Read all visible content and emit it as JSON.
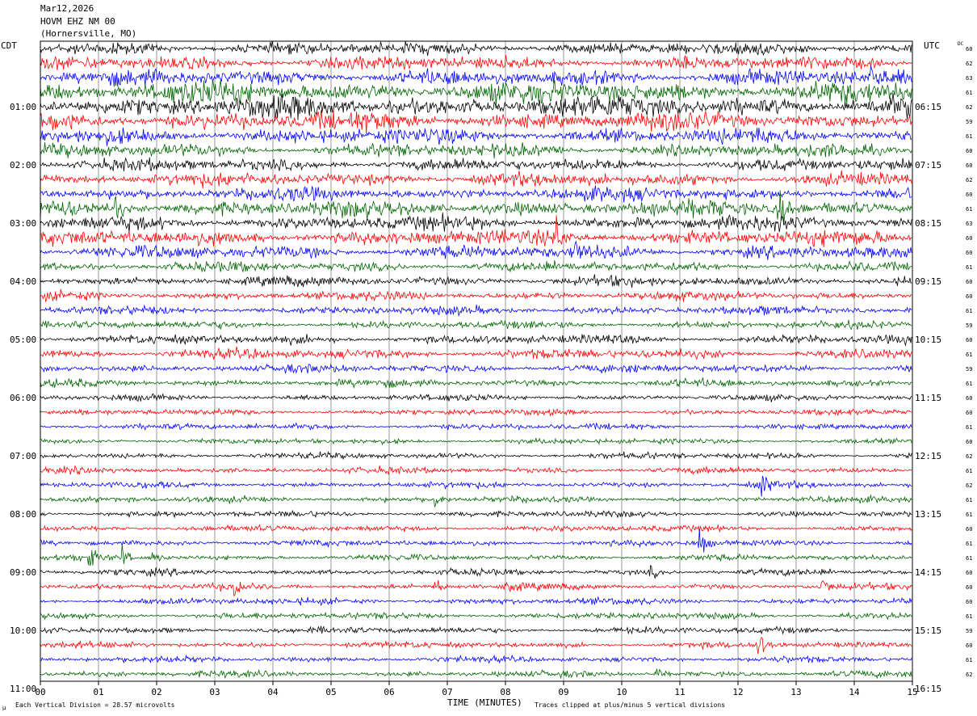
{
  "header": {
    "date": "Mar12,2026",
    "station": "HOVM EHZ NM 00",
    "location": "(Hornersville, MO)"
  },
  "labels": {
    "left_tz": "CDT",
    "right_tz": "UTC",
    "dc": "DC",
    "xlabel": "TIME (MINUTES)",
    "scale_note": "Each Vertical Division =   28.57 microvolts",
    "clip_note": "Traces clipped at plus/minus 5 vertical divisions",
    "corner_mark": "µ"
  },
  "colors": {
    "trace_cycle": [
      "#000000",
      "#ff0000",
      "#0000ff",
      "#006400"
    ],
    "grid": "#808080",
    "frame": "#000000",
    "background": "#ffffff"
  },
  "chart_data": {
    "type": "line",
    "description_type": "helicorder",
    "x_range": [
      0,
      15
    ],
    "x_ticks": [
      "00",
      "01",
      "02",
      "03",
      "04",
      "05",
      "06",
      "07",
      "08",
      "09",
      "10",
      "11",
      "12",
      "13",
      "14",
      "15"
    ],
    "trace_minutes": 15,
    "left_hour_labels": [
      "01:00",
      "02:00",
      "03:00",
      "04:00",
      "05:00",
      "06:00",
      "07:00",
      "08:00",
      "09:00",
      "10:00",
      "11:00"
    ],
    "right_hour_labels": [
      "06:15",
      "07:15",
      "08:15",
      "09:15",
      "10:15",
      "11:15",
      "12:15",
      "13:15",
      "14:15",
      "15:15",
      "16:15"
    ],
    "hour_label_first_trace": 4,
    "traces_per_hour": 4,
    "dc_offsets": [
      60,
      62,
      63,
      61,
      62,
      59,
      61,
      60,
      60,
      62,
      60,
      61,
      63,
      60,
      60,
      61,
      60,
      60,
      61,
      59,
      60,
      61,
      59,
      61,
      60,
      60,
      61,
      60,
      62,
      61,
      62,
      61,
      61,
      60,
      61,
      61,
      60,
      60,
      60,
      61,
      59,
      60,
      61,
      62
    ],
    "amplitudes": [
      0.55,
      0.6,
      0.7,
      1.0,
      1.0,
      0.85,
      0.7,
      0.6,
      0.55,
      0.6,
      0.6,
      0.75,
      0.65,
      0.7,
      0.6,
      0.45,
      0.45,
      0.4,
      0.38,
      0.35,
      0.42,
      0.45,
      0.38,
      0.35,
      0.28,
      0.27,
      0.27,
      0.25,
      0.28,
      0.28,
      0.28,
      0.28,
      0.28,
      0.28,
      0.28,
      0.27,
      0.28,
      0.28,
      0.3,
      0.3,
      0.3,
      0.28,
      0.27,
      0.28
    ],
    "events": [
      {
        "trace": 11,
        "minute": 1.3,
        "amp": 1.6
      },
      {
        "trace": 11,
        "minute": 12.7,
        "amp": 2.8
      },
      {
        "trace": 13,
        "minute": 8.9,
        "amp": 1.6
      },
      {
        "trace": 14,
        "minute": 9.2,
        "amp": 1.4
      },
      {
        "trace": 2,
        "minute": 14.3,
        "amp": 1.2
      },
      {
        "trace": 30,
        "minute": 12.4,
        "amp": 1.3
      },
      {
        "trace": 31,
        "minute": 6.8,
        "amp": 1.0
      },
      {
        "trace": 34,
        "minute": 11.35,
        "amp": 1.5
      },
      {
        "trace": 35,
        "minute": 0.85,
        "amp": 0.9
      },
      {
        "trace": 35,
        "minute": 1.4,
        "amp": 1.0
      },
      {
        "trace": 35,
        "minute": 1.95,
        "amp": 0.8
      },
      {
        "trace": 37,
        "minute": 3.35,
        "amp": 1.1
      },
      {
        "trace": 37,
        "minute": 6.8,
        "amp": 1.0
      },
      {
        "trace": 37,
        "minute": 8.05,
        "amp": 1.0
      },
      {
        "trace": 37,
        "minute": 13.45,
        "amp": 0.9
      },
      {
        "trace": 36,
        "minute": 10.5,
        "amp": 0.7
      },
      {
        "trace": 41,
        "minute": 12.35,
        "amp": 1.6
      },
      {
        "trace": 43,
        "minute": 10.6,
        "amp": 0.8
      }
    ]
  }
}
